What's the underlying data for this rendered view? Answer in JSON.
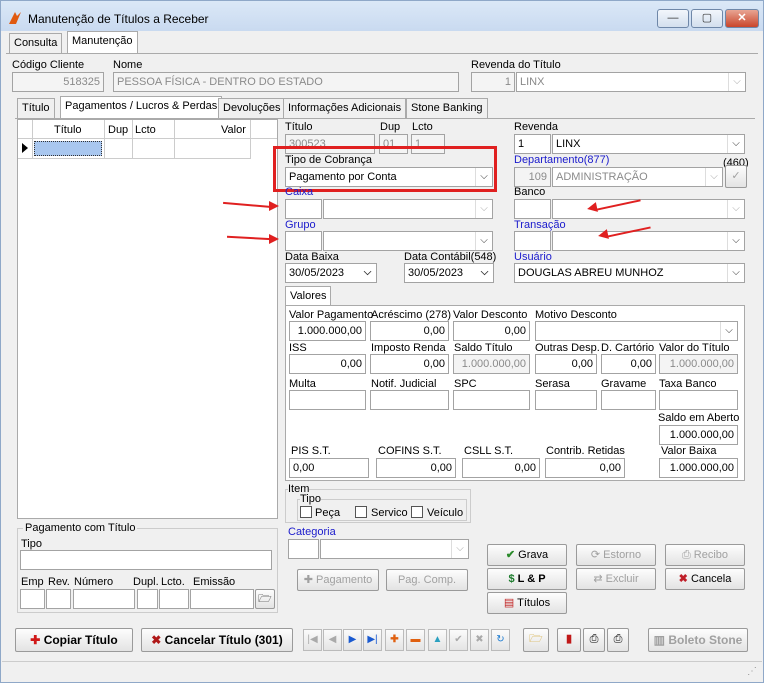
{
  "window": {
    "title": "Manutenção de Títulos a Receber",
    "minimize": "—",
    "maximize": "▢",
    "close": "✕"
  },
  "main_tabs": [
    "Consulta",
    "Manutenção"
  ],
  "header": {
    "codigo_label": "Código Cliente",
    "codigo_value": "518325",
    "nome_label": "Nome",
    "nome_value": "PESSOA FÍSICA - DENTRO DO ESTADO",
    "revenda_label": "Revenda do Título",
    "revenda_num": "1",
    "revenda_name": "LINX"
  },
  "sub_tabs": [
    "Título",
    "Pagamentos / Lucros & Perdas",
    "Devoluções",
    "Informações Adicionais",
    "Stone Banking"
  ],
  "grid": {
    "columns": [
      "Título",
      "Dup",
      "Lcto",
      "Valor"
    ]
  },
  "pagamento_titulo": {
    "title": "Pagamento com Título",
    "tipo_label": "Tipo",
    "emp": "Emp",
    "rev": "Rev.",
    "numero": "Número",
    "dupl": "Dupl.",
    "lcto": "Lcto.",
    "emissao": "Emissão"
  },
  "form": {
    "titulo_label": "Título",
    "titulo_value": "300523",
    "dup_label": "Dup",
    "dup_value": "01",
    "lcto_label": "Lcto",
    "lcto_value": "1",
    "revenda_label": "Revenda",
    "revenda_num": "1",
    "revenda_name": "LINX",
    "tipo_cobranca_label": "Tipo de Cobrança",
    "tipo_cobranca_value": "Pagamento por Conta",
    "departamento_label": "Departamento(877)",
    "departamento_count": "(460)",
    "departamento_num": "109",
    "departamento_name": "ADMINISTRAÇÃO",
    "caixa_label": "Caixa",
    "banco_label": "Banco",
    "grupo_label": "Grupo",
    "transacao_label": "Transação",
    "data_baixa_label": "Data Baixa",
    "data_baixa_value": "30/05/2023",
    "data_contabil_label": "Data Contábil(548)",
    "data_contabil_value": "30/05/2023",
    "usuario_label": "Usuário",
    "usuario_value": "DOUGLAS ABREU MUNHOZ"
  },
  "valores": {
    "tab": "Valores",
    "valor_pagamento_label": "Valor Pagamento",
    "valor_pagamento": "1.000.000,00",
    "acrescimo_label": "Acréscimo (278)",
    "acrescimo": "0,00",
    "valor_desconto_label": "Valor Desconto",
    "valor_desconto": "0,00",
    "motivo_desconto_label": "Motivo Desconto",
    "iss_label": "ISS",
    "iss": "0,00",
    "imposto_renda_label": "Imposto Renda",
    "imposto_renda": "0,00",
    "saldo_titulo_label": "Saldo Título",
    "saldo_titulo": "1.000.000,00",
    "outras_desp_label": "Outras Desp.",
    "outras_desp": "0,00",
    "d_cartorio_label": "D. Cartório",
    "d_cartorio": "0,00",
    "valor_titulo_label": "Valor do Título",
    "valor_titulo": "1.000.000,00",
    "multa_label": "Multa",
    "notif_label": "Notif. Judicial",
    "spc_label": "SPC",
    "serasa_label": "Serasa",
    "gravame_label": "Gravame",
    "taxa_banco_label": "Taxa Banco",
    "saldo_aberto_label": "Saldo em Aberto",
    "saldo_aberto": "1.000.000,00",
    "pis_label": "PIS S.T.",
    "pis": "0,00",
    "cofins_label": "COFINS S.T.",
    "cofins": "0,00",
    "csll_label": "CSLL S.T.",
    "csll": "0,00",
    "contrib_label": "Contrib. Retidas",
    "contrib": "0,00",
    "valor_baixa_label": "Valor Baixa",
    "valor_baixa": "1.000.000,00"
  },
  "item": {
    "title": "Item",
    "tipo": "Tipo",
    "peca": "Peça",
    "servico": "Servico",
    "veiculo": "Veículo",
    "categoria": "Categoria"
  },
  "buttons": {
    "pagamento": "Pagamento",
    "pag_comp": "Pag. Comp.",
    "grava": "Grava",
    "estorno": "Estorno",
    "recibo": "Recibo",
    "lp": "L & P",
    "excluir": "Excluir",
    "cancela": "Cancela",
    "titulos": "Títulos",
    "copiar": "Copiar Título",
    "cancelar_titulo": "Cancelar Título (301)",
    "boleto": "Boleto Stone"
  },
  "colors": {
    "accent": "#1a1acc",
    "highlight": "#e02020"
  }
}
